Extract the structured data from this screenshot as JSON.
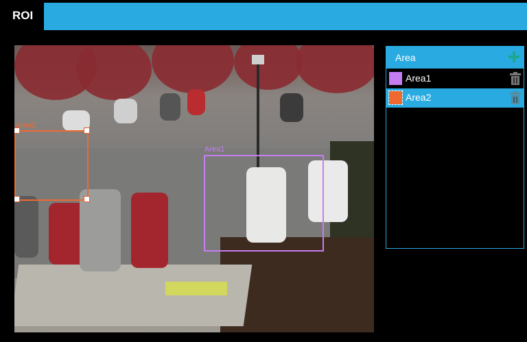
{
  "tabs": [
    {
      "label": "ROI"
    }
  ],
  "colors": {
    "accent": "#29abe2",
    "area1": "#c77df2",
    "area2": "#f06a30",
    "add": "#1aa890"
  },
  "video": {
    "overlays": [
      {
        "label": "Area1",
        "color": "#c77df2"
      },
      {
        "label": "Area2",
        "color": "#f06a30"
      }
    ]
  },
  "area_panel": {
    "title": "Area",
    "add_icon": "plus-icon",
    "items": [
      {
        "label": "Area1",
        "color": "#c77df2",
        "selected": false,
        "delete_icon": "trash-icon"
      },
      {
        "label": "Area2",
        "color": "#f06a30",
        "selected": true,
        "delete_icon": "trash-icon"
      }
    ]
  }
}
